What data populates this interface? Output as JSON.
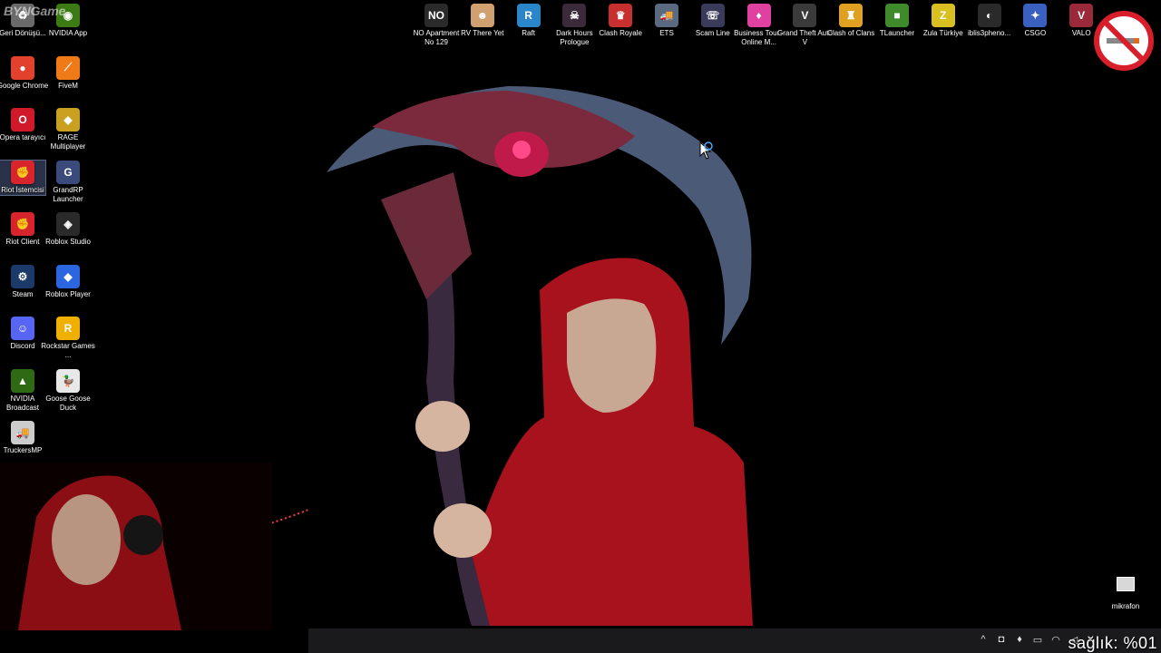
{
  "watermark": "BYNGame",
  "colors": {
    "hoodie": "#b01218",
    "scythe_blade": "#5a6c8c",
    "scythe_red": "#8a2a3a",
    "no_smoking_red": "#d81e2a"
  },
  "left_icons": [
    {
      "label": "Geri Dönüşü...",
      "icon": "recycle-bin-icon",
      "color": "#6a6a6a",
      "glyph": "♻"
    },
    {
      "label": "NVIDIA App",
      "icon": "nvidia-icon",
      "color": "#3c7a14",
      "glyph": "◉"
    },
    {
      "label": "Google Chrome",
      "icon": "chrome-icon",
      "color": "#e2412d",
      "glyph": "●"
    },
    {
      "label": "FiveM",
      "icon": "fivem-icon",
      "color": "#f07a18",
      "glyph": "⟋"
    },
    {
      "label": "Opera tarayıcı",
      "icon": "opera-icon",
      "color": "#d01a2a",
      "glyph": "O"
    },
    {
      "label": "RAGE Multiplayer",
      "icon": "rage-mp-icon",
      "color": "#c9a020",
      "glyph": "◆"
    },
    {
      "label": "Riot İstemcisi",
      "icon": "riot-client-icon",
      "color": "#d8242c",
      "glyph": "✊"
    },
    {
      "label": "GrandRP Launcher",
      "icon": "grandrp-icon",
      "color": "#3a4a7a",
      "glyph": "G"
    },
    {
      "label": "Riot Client",
      "icon": "riot-client-icon",
      "color": "#d8242c",
      "glyph": "✊"
    },
    {
      "label": "Roblox Studio",
      "icon": "roblox-studio-icon",
      "color": "#2a2a2a",
      "glyph": "◈"
    },
    {
      "label": "Steam",
      "icon": "steam-icon",
      "color": "#1b3a6a",
      "glyph": "⚙"
    },
    {
      "label": "Roblox Player",
      "icon": "roblox-player-icon",
      "color": "#2b66e0",
      "glyph": "◆"
    },
    {
      "label": "Discord",
      "icon": "discord-icon",
      "color": "#5865f2",
      "glyph": "☺"
    },
    {
      "label": "Rockstar Games ...",
      "icon": "rockstar-icon",
      "color": "#f0b000",
      "glyph": "R"
    },
    {
      "label": "NVIDIA Broadcast",
      "icon": "nvidia-broadcast-icon",
      "color": "#2e6a14",
      "glyph": "▲"
    },
    {
      "label": "Goose Goose Duck",
      "icon": "goose-goose-duck-icon",
      "color": "#e8e8e8",
      "glyph": "🦆"
    },
    {
      "label": "TruckersMP",
      "icon": "truckersmp-icon",
      "color": "#cccccc",
      "glyph": "🚚"
    }
  ],
  "top_icons": [
    {
      "label": "NO Apartment No 129",
      "icon": "apartment-no129-icon",
      "color": "#2a2a2a",
      "glyph": "NO"
    },
    {
      "label": "RV There Yet",
      "icon": "rv-there-yet-icon",
      "color": "#d0a070",
      "glyph": "☻"
    },
    {
      "label": "Raft",
      "icon": "raft-icon",
      "color": "#2a86c8",
      "glyph": "R"
    },
    {
      "label": "Dark Hours Prologue",
      "icon": "dark-hours-icon",
      "color": "#3a2a3a",
      "glyph": "☠"
    },
    {
      "label": "Clash Royale",
      "icon": "clash-royale-icon",
      "color": "#c83030",
      "glyph": "♛"
    },
    {
      "label": "ETS",
      "icon": "ets-icon",
      "color": "#5a6a80",
      "glyph": "🚚"
    },
    {
      "label": "Scam Line",
      "icon": "scam-line-icon",
      "color": "#3a3a5a",
      "glyph": "☏"
    },
    {
      "label": "Business Tour - Online M...",
      "icon": "business-tour-icon",
      "color": "#e040a0",
      "glyph": "♦"
    },
    {
      "label": "Grand Theft Auto V",
      "icon": "gta-v-icon",
      "color": "#3a3a3a",
      "glyph": "V"
    },
    {
      "label": "Clash of Clans",
      "icon": "clash-of-clans-icon",
      "color": "#e0a020",
      "glyph": "♜"
    },
    {
      "label": "TLauncher",
      "icon": "tlauncher-icon",
      "color": "#3f8a2a",
      "glyph": "■"
    },
    {
      "label": "Zula Türkiye",
      "icon": "zula-icon",
      "color": "#d8c020",
      "glyph": "Z"
    },
    {
      "label": "iblis3pheno...",
      "icon": "iblis3-icon",
      "color": "#2a2a2a",
      "glyph": "◐"
    },
    {
      "label": "CSGO",
      "icon": "csgo-icon",
      "color": "#3a60c0",
      "glyph": "✦"
    },
    {
      "label": "VALO",
      "icon": "valorant-icon",
      "color": "#9a2a3a",
      "glyph": "V"
    }
  ],
  "desktop_shortcut": {
    "label": "mikrafon",
    "icon": "mikrafon-icon"
  },
  "overlay_text": "sağlık: %01",
  "tray_icons": [
    "chevron-up-icon",
    "camera-icon",
    "mic-icon",
    "network-icon",
    "wifi-icon",
    "volume-icon"
  ]
}
